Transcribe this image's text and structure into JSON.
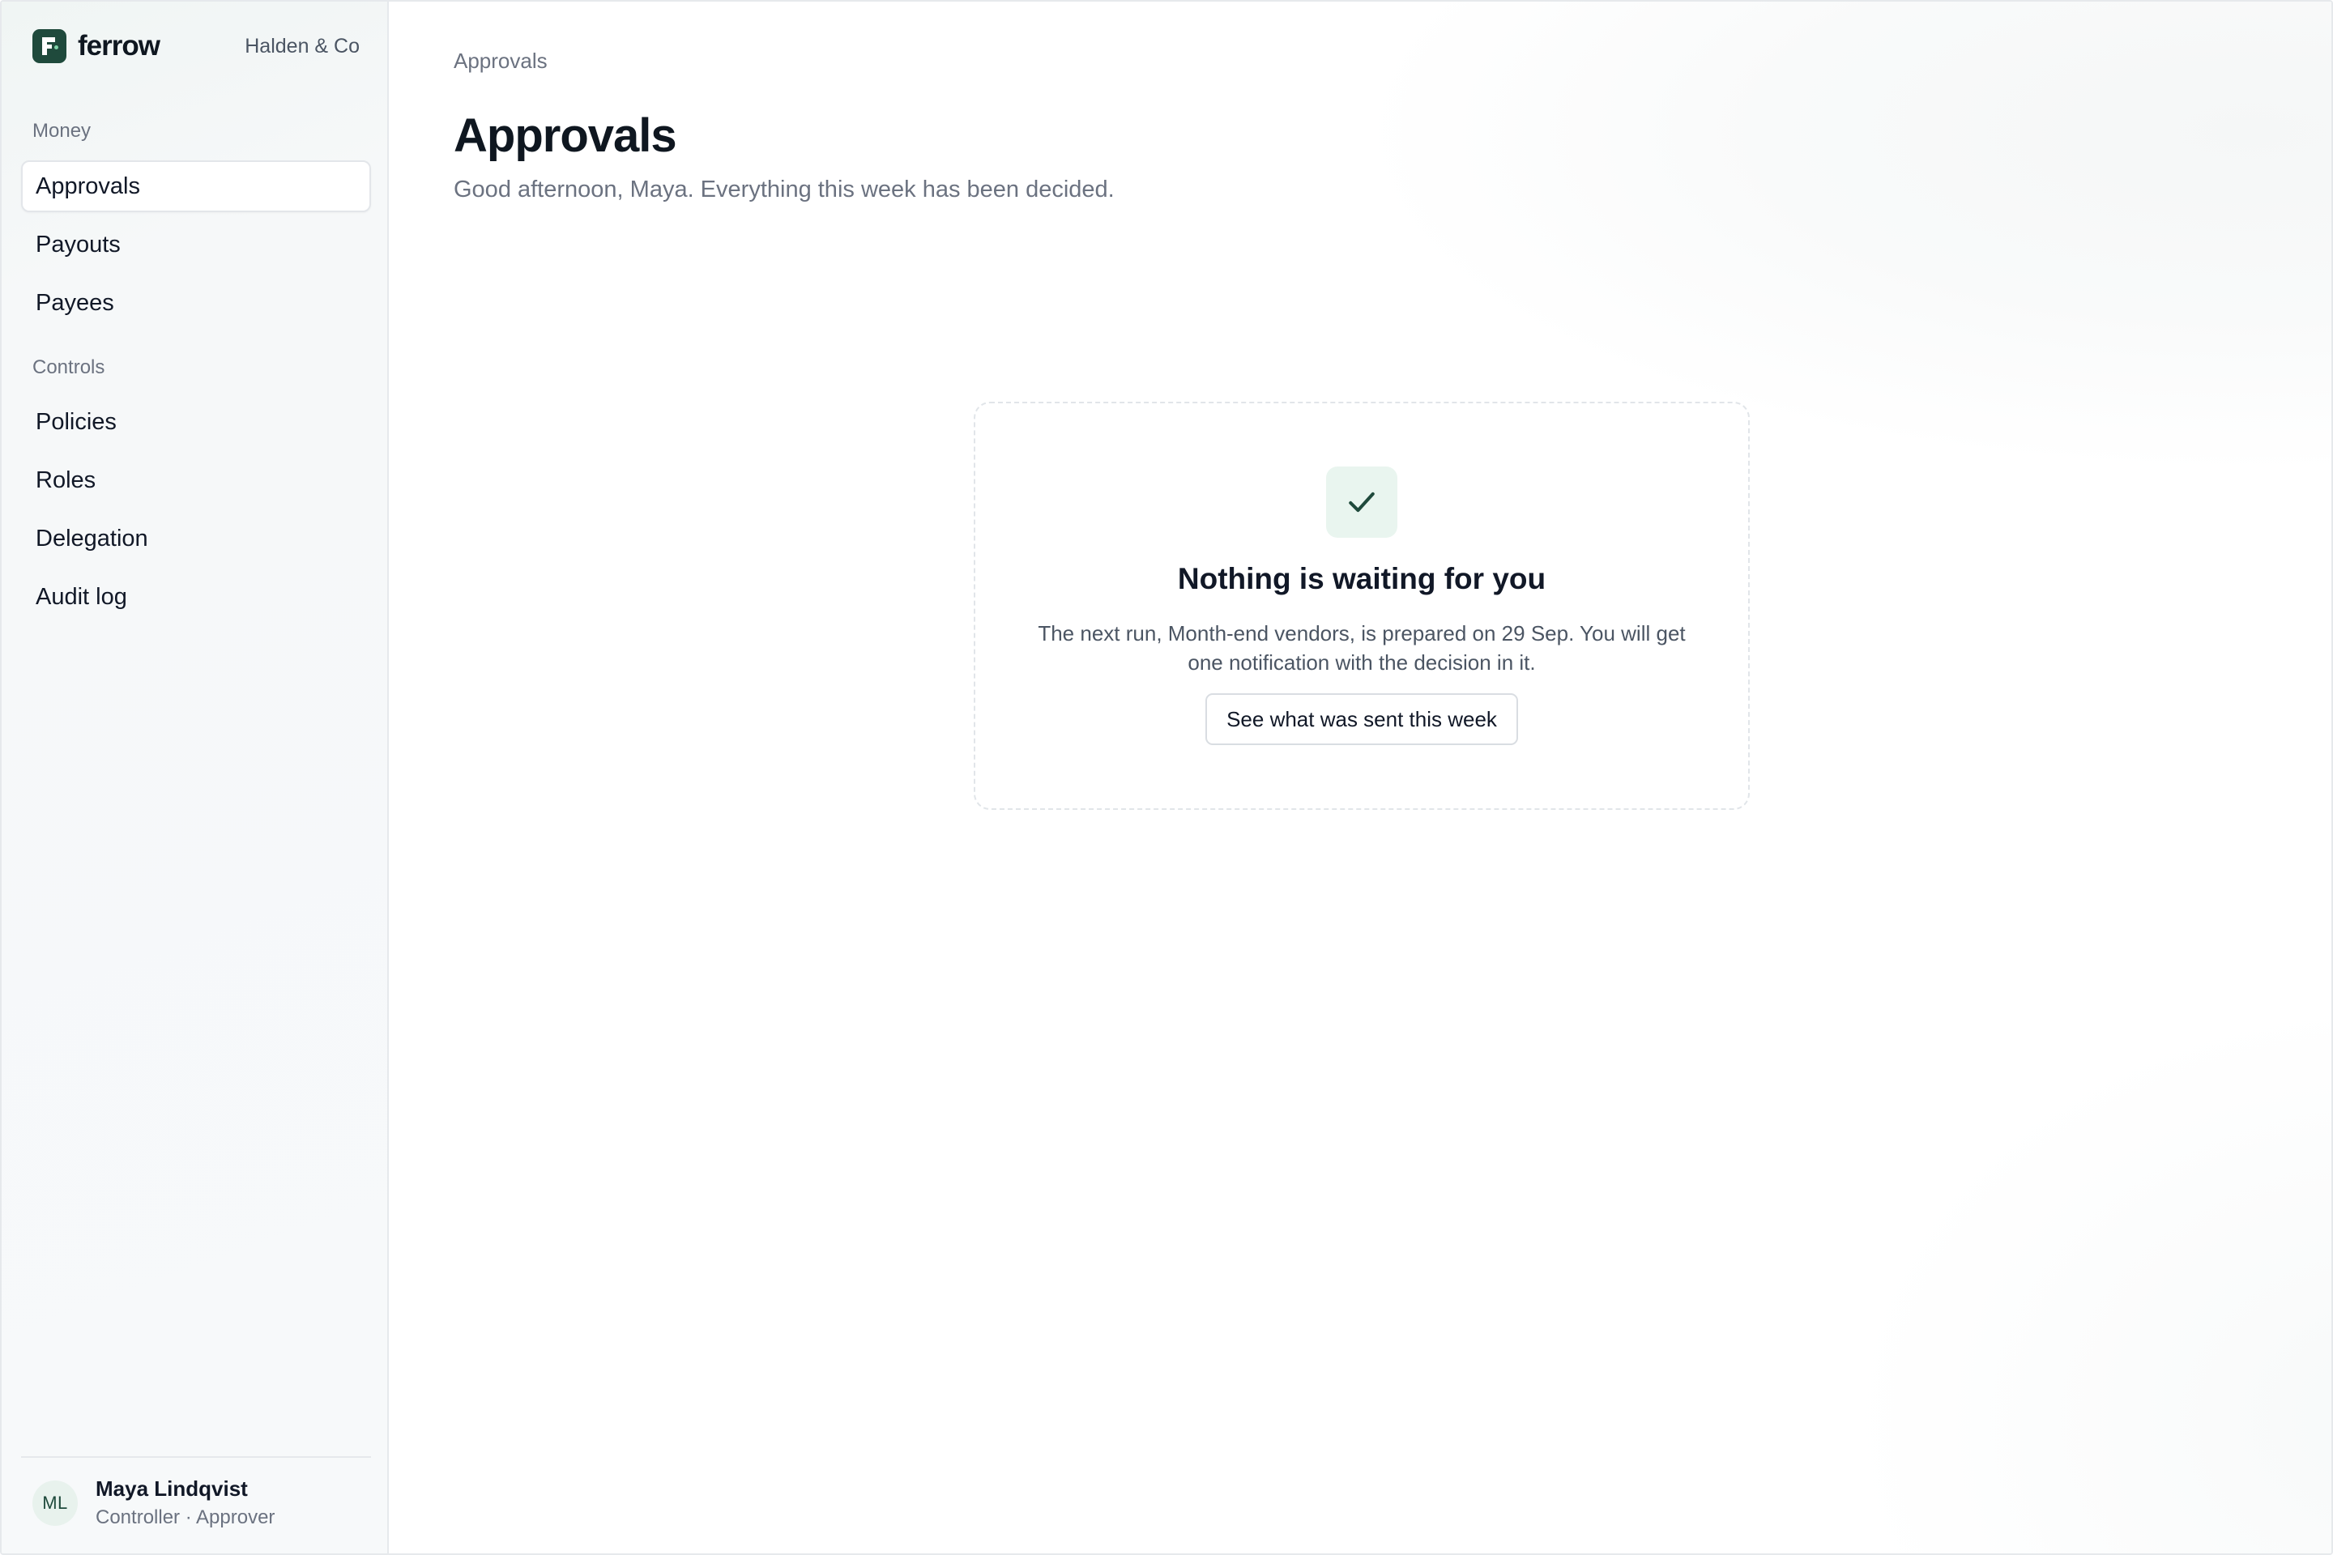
{
  "brand": {
    "name": "ferrow",
    "org": "Halden & Co"
  },
  "sidebar": {
    "sections": [
      {
        "label": "Money",
        "items": [
          {
            "label": "Approvals",
            "active": true
          },
          {
            "label": "Payouts"
          },
          {
            "label": "Payees"
          }
        ]
      },
      {
        "label": "Controls",
        "items": [
          {
            "label": "Policies"
          },
          {
            "label": "Roles"
          },
          {
            "label": "Delegation"
          },
          {
            "label": "Audit log"
          }
        ]
      }
    ],
    "user": {
      "initials": "ML",
      "name": "Maya Lindqvist",
      "role": "Controller · Approver"
    }
  },
  "main": {
    "breadcrumb": "Approvals",
    "title": "Approvals",
    "subtitle": "Good afternoon, Maya. Everything this week has been decided.",
    "empty_state": {
      "icon": "check-icon",
      "title": "Nothing is waiting for you",
      "body": "The next run, Month-end vendors, is prepared on 29 Sep. You will get one notification with the decision in it.",
      "button_label": "See what was sent this week"
    }
  },
  "colors": {
    "brand": "#1f4a3c",
    "accent_soft": "#e9f5ef",
    "sidebar_bg": "#f7f9fa",
    "text_primary": "#111827",
    "text_muted": "#6b7280"
  }
}
